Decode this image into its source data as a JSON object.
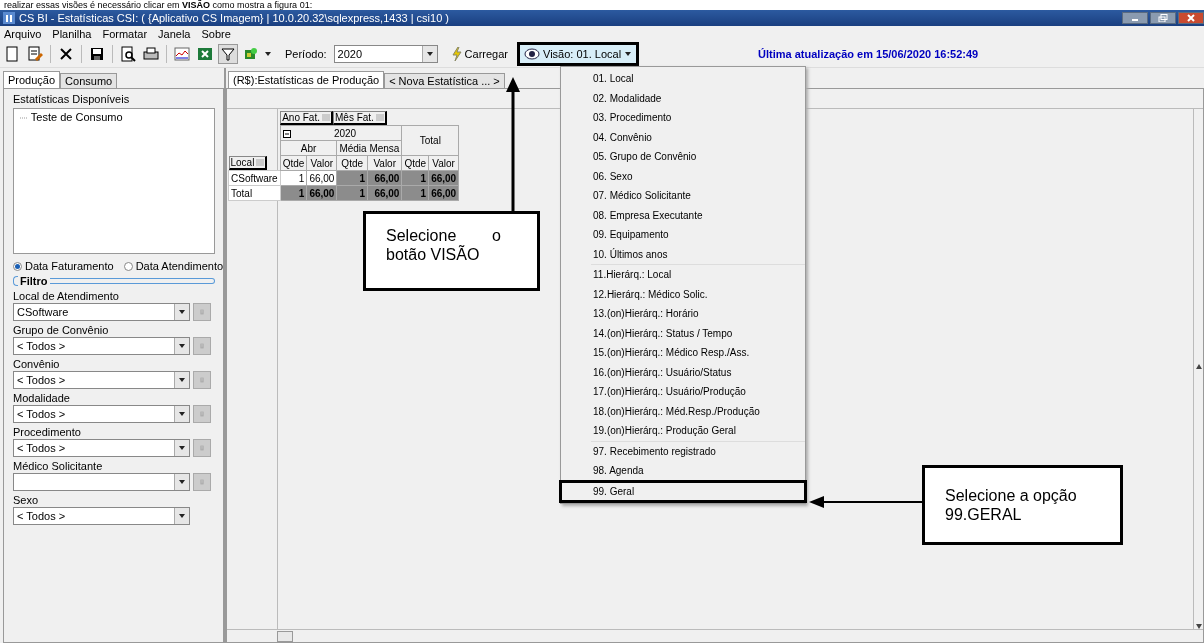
{
  "document_text": "realizar essas visões é necessário clicar em **VISÃO** como mostra a figura 01:",
  "window": {
    "title": "CS BI - Estatísticas CSI: ( {Aplicativo CS Imagem} | 10.0.20.32\\sqlexpress,1433 | csi10 )"
  },
  "menu": [
    "Arquivo",
    "Planilha",
    "Formatar",
    "Janela",
    "Sobre"
  ],
  "toolbar": {
    "period_label": "Período:",
    "period_value": "2020",
    "load_button": "Carregar",
    "view_button": {
      "label": "Visão: 01. Local",
      "outlined": true
    },
    "last_update": "Última atualização em 15/06/2020 16:52:49"
  },
  "left_panel": {
    "tabs": [
      {
        "label": "Produção",
        "selected": true
      },
      {
        "label": "Consumo",
        "selected": false
      }
    ],
    "list_title": "Estatísticas Disponíveis",
    "list_items": [
      "Teste de Consumo"
    ],
    "date_options": [
      {
        "label": "Data Faturamento",
        "selected": true
      },
      {
        "label": "Data Atendimento",
        "selected": false
      }
    ],
    "filter_title": "Filtro",
    "filters": [
      {
        "label": "Local de Atendimento",
        "value": "CSoftware",
        "has_picker": true
      },
      {
        "label": "Grupo de Convênio",
        "value": "< Todos >",
        "has_picker": true
      },
      {
        "label": "Convênio",
        "value": "< Todos >",
        "has_picker": true
      },
      {
        "label": "Modalidade",
        "value": "< Todos >",
        "has_picker": true
      },
      {
        "label": "Procedimento",
        "value": "< Todos >",
        "has_picker": true
      },
      {
        "label": "Médico Solicitante",
        "has_picker": true
      },
      {
        "label": "Sexo",
        "value": "< Todos >",
        "has_picker": false
      }
    ]
  },
  "report_tabs": [
    {
      "label": "(R$):Estatísticas de Produção",
      "selected": true
    },
    {
      "label": "< Nova Estatística ... >",
      "selected": false
    }
  ],
  "pivot": {
    "column_fields": [
      "Ano Fat.",
      "Mês Fat."
    ],
    "row_field": "Local",
    "year": "2020",
    "periods": [
      "Abr",
      "Média Mensa"
    ],
    "total_header": "Total",
    "measures": [
      "Qtde",
      "Valor",
      "Qtde",
      "Valor",
      "Qtde",
      "Valor"
    ],
    "rows": [
      {
        "label": "CSoftware",
        "kind": "data",
        "cells": [
          "1",
          "66,00",
          "1",
          "66,00",
          "1",
          "66,00"
        ]
      },
      {
        "label": "Total",
        "kind": "total",
        "cells": [
          "1",
          "66,00",
          "1",
          "66,00",
          "1",
          "66,00"
        ]
      }
    ]
  },
  "view_menu": {
    "groups": [
      [
        {
          "label": "01. Local",
          "outlined": false
        },
        {
          "label": "02. Modalidade",
          "outlined": false
        },
        {
          "label": "03. Procedimento",
          "outlined": false
        },
        {
          "label": "04. Convênio",
          "outlined": false
        },
        {
          "label": "05. Grupo de Convênio",
          "outlined": false
        },
        {
          "label": "06. Sexo",
          "outlined": false
        },
        {
          "label": "07. Médico Solicitante",
          "outlined": false
        },
        {
          "label": "08. Empresa Executante",
          "outlined": false
        },
        {
          "label": "09. Equipamento",
          "outlined": false
        },
        {
          "label": "10. Últimos anos",
          "outlined": false
        }
      ],
      [
        {
          "label": "11.Hierárq.: Local",
          "outlined": false
        },
        {
          "label": "12.Hierárq.: Médico Solic.",
          "outlined": false
        },
        {
          "label": "13.(on)Hierárq.: Horário",
          "outlined": false
        },
        {
          "label": "14.(on)Hierárq.: Status / Tempo",
          "outlined": false
        },
        {
          "label": "15.(on)Hierárq.: Médico Resp./Ass.",
          "outlined": false
        },
        {
          "label": "16.(on)Hierárq.: Usuário/Status",
          "outlined": false
        },
        {
          "label": "17.(on)Hierárq.: Usuário/Produção",
          "outlined": false
        },
        {
          "label": "18.(on)Hierárq.: Méd.Resp./Produção",
          "outlined": false
        },
        {
          "label": "19.(on)Hierárq.: Produção Geral",
          "outlined": false
        }
      ],
      [
        {
          "label": "97. Recebimento registrado",
          "outlined": false
        },
        {
          "label": "98. Agenda",
          "outlined": false
        }
      ],
      [
        {
          "label": "99. Geral",
          "outlined": true
        }
      ]
    ]
  },
  "callouts": [
    {
      "text": "Selecione o botão VISÃO"
    },
    {
      "text": "Selecione a opção 99.GERAL"
    }
  ]
}
